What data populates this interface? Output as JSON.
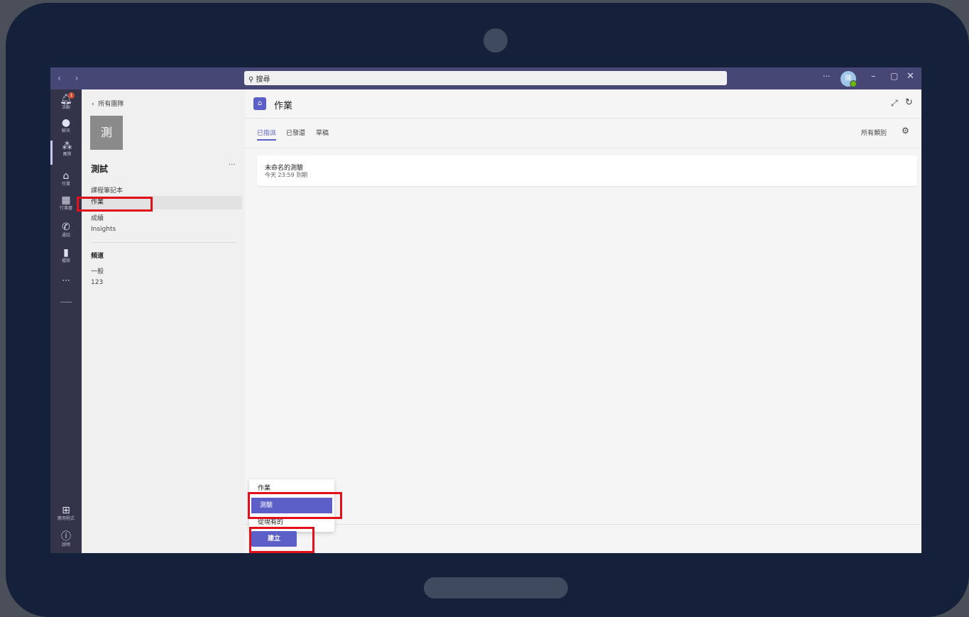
{
  "titlebar": {
    "search_placeholder": "搜尋",
    "more": "···",
    "avatar_initial": "陳",
    "minimize": "–",
    "maximize": "▢",
    "close": "✕"
  },
  "rail": {
    "items": [
      {
        "icon": "bell-icon",
        "label": "活動",
        "badge": "1"
      },
      {
        "icon": "chat-icon",
        "label": "聊天"
      },
      {
        "icon": "teams-icon",
        "label": "團隊"
      },
      {
        "icon": "assignments-icon",
        "label": "作業"
      },
      {
        "icon": "calendar-icon",
        "label": "行事曆"
      },
      {
        "icon": "phone-icon",
        "label": "通話"
      },
      {
        "icon": "file-icon",
        "label": "檔案"
      }
    ],
    "more": "···",
    "apps_label": "應用程式",
    "help_label": "說明"
  },
  "teampane": {
    "back_label": "所有團隊",
    "tile_char": "測",
    "team_name": "測試",
    "more": "···",
    "items": [
      "課程筆記本",
      "作業",
      "成績",
      "Insights"
    ],
    "channels_title": "頻道",
    "channels": [
      "一般",
      "123"
    ]
  },
  "main": {
    "title": "作業",
    "tabs": [
      "已指派",
      "已發還",
      "草稿"
    ],
    "filter": "所有類別",
    "card": {
      "title": "未命名的測驗",
      "due": "今天 23:59 到期"
    },
    "menu": [
      "作業",
      "測驗",
      "從現有的"
    ],
    "create_label": "建立"
  },
  "colors": {
    "accent": "#5b5fc7",
    "titlebar": "#464775",
    "rail": "#33344a",
    "highlight": "#e3101b"
  }
}
